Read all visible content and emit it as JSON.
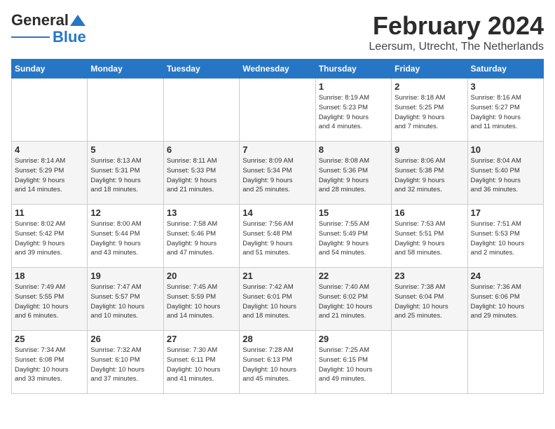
{
  "logo": {
    "line1": "General",
    "line2": "Blue"
  },
  "title": "February 2024",
  "subtitle": "Leersum, Utrecht, The Netherlands",
  "weekdays": [
    "Sunday",
    "Monday",
    "Tuesday",
    "Wednesday",
    "Thursday",
    "Friday",
    "Saturday"
  ],
  "weeks": [
    [
      {
        "day": "",
        "info": ""
      },
      {
        "day": "",
        "info": ""
      },
      {
        "day": "",
        "info": ""
      },
      {
        "day": "",
        "info": ""
      },
      {
        "day": "1",
        "info": "Sunrise: 8:19 AM\nSunset: 5:23 PM\nDaylight: 9 hours\nand 4 minutes."
      },
      {
        "day": "2",
        "info": "Sunrise: 8:18 AM\nSunset: 5:25 PM\nDaylight: 9 hours\nand 7 minutes."
      },
      {
        "day": "3",
        "info": "Sunrise: 8:16 AM\nSunset: 5:27 PM\nDaylight: 9 hours\nand 11 minutes."
      }
    ],
    [
      {
        "day": "4",
        "info": "Sunrise: 8:14 AM\nSunset: 5:29 PM\nDaylight: 9 hours\nand 14 minutes."
      },
      {
        "day": "5",
        "info": "Sunrise: 8:13 AM\nSunset: 5:31 PM\nDaylight: 9 hours\nand 18 minutes."
      },
      {
        "day": "6",
        "info": "Sunrise: 8:11 AM\nSunset: 5:33 PM\nDaylight: 9 hours\nand 21 minutes."
      },
      {
        "day": "7",
        "info": "Sunrise: 8:09 AM\nSunset: 5:34 PM\nDaylight: 9 hours\nand 25 minutes."
      },
      {
        "day": "8",
        "info": "Sunrise: 8:08 AM\nSunset: 5:36 PM\nDaylight: 9 hours\nand 28 minutes."
      },
      {
        "day": "9",
        "info": "Sunrise: 8:06 AM\nSunset: 5:38 PM\nDaylight: 9 hours\nand 32 minutes."
      },
      {
        "day": "10",
        "info": "Sunrise: 8:04 AM\nSunset: 5:40 PM\nDaylight: 9 hours\nand 36 minutes."
      }
    ],
    [
      {
        "day": "11",
        "info": "Sunrise: 8:02 AM\nSunset: 5:42 PM\nDaylight: 9 hours\nand 39 minutes."
      },
      {
        "day": "12",
        "info": "Sunrise: 8:00 AM\nSunset: 5:44 PM\nDaylight: 9 hours\nand 43 minutes."
      },
      {
        "day": "13",
        "info": "Sunrise: 7:58 AM\nSunset: 5:46 PM\nDaylight: 9 hours\nand 47 minutes."
      },
      {
        "day": "14",
        "info": "Sunrise: 7:56 AM\nSunset: 5:48 PM\nDaylight: 9 hours\nand 51 minutes."
      },
      {
        "day": "15",
        "info": "Sunrise: 7:55 AM\nSunset: 5:49 PM\nDaylight: 9 hours\nand 54 minutes."
      },
      {
        "day": "16",
        "info": "Sunrise: 7:53 AM\nSunset: 5:51 PM\nDaylight: 9 hours\nand 58 minutes."
      },
      {
        "day": "17",
        "info": "Sunrise: 7:51 AM\nSunset: 5:53 PM\nDaylight: 10 hours\nand 2 minutes."
      }
    ],
    [
      {
        "day": "18",
        "info": "Sunrise: 7:49 AM\nSunset: 5:55 PM\nDaylight: 10 hours\nand 6 minutes."
      },
      {
        "day": "19",
        "info": "Sunrise: 7:47 AM\nSunset: 5:57 PM\nDaylight: 10 hours\nand 10 minutes."
      },
      {
        "day": "20",
        "info": "Sunrise: 7:45 AM\nSunset: 5:59 PM\nDaylight: 10 hours\nand 14 minutes."
      },
      {
        "day": "21",
        "info": "Sunrise: 7:42 AM\nSunset: 6:01 PM\nDaylight: 10 hours\nand 18 minutes."
      },
      {
        "day": "22",
        "info": "Sunrise: 7:40 AM\nSunset: 6:02 PM\nDaylight: 10 hours\nand 21 minutes."
      },
      {
        "day": "23",
        "info": "Sunrise: 7:38 AM\nSunset: 6:04 PM\nDaylight: 10 hours\nand 25 minutes."
      },
      {
        "day": "24",
        "info": "Sunrise: 7:36 AM\nSunset: 6:06 PM\nDaylight: 10 hours\nand 29 minutes."
      }
    ],
    [
      {
        "day": "25",
        "info": "Sunrise: 7:34 AM\nSunset: 6:08 PM\nDaylight: 10 hours\nand 33 minutes."
      },
      {
        "day": "26",
        "info": "Sunrise: 7:32 AM\nSunset: 6:10 PM\nDaylight: 10 hours\nand 37 minutes."
      },
      {
        "day": "27",
        "info": "Sunrise: 7:30 AM\nSunset: 6:11 PM\nDaylight: 10 hours\nand 41 minutes."
      },
      {
        "day": "28",
        "info": "Sunrise: 7:28 AM\nSunset: 6:13 PM\nDaylight: 10 hours\nand 45 minutes."
      },
      {
        "day": "29",
        "info": "Sunrise: 7:25 AM\nSunset: 6:15 PM\nDaylight: 10 hours\nand 49 minutes."
      },
      {
        "day": "",
        "info": ""
      },
      {
        "day": "",
        "info": ""
      }
    ]
  ]
}
